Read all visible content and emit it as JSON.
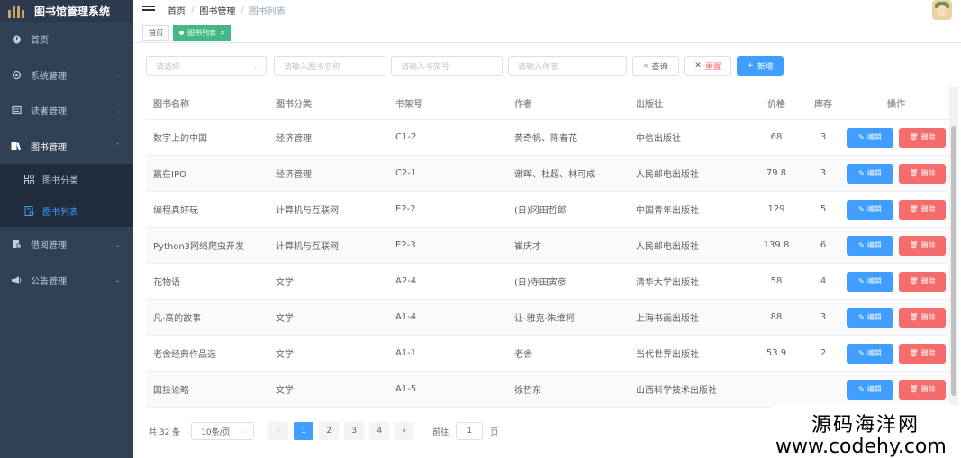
{
  "app": {
    "title": "图书馆管理系统"
  },
  "sidebar": {
    "items": [
      {
        "label": "首页",
        "icon": "dashboard-icon"
      },
      {
        "label": "系统管理",
        "icon": "gear-icon"
      },
      {
        "label": "读者管理",
        "icon": "reader-icon"
      },
      {
        "label": "图书管理",
        "icon": "books-icon"
      },
      {
        "label": "借阅管理",
        "icon": "borrow-icon"
      },
      {
        "label": "公告管理",
        "icon": "megaphone-icon"
      }
    ],
    "submenu": [
      {
        "label": "图书分类",
        "icon": "category-icon"
      },
      {
        "label": "图书列表",
        "icon": "list-icon"
      }
    ]
  },
  "header": {
    "breadcrumb": [
      "首页",
      "图书管理",
      "图书列表"
    ]
  },
  "tags": {
    "home": "首页",
    "active": "图书列表"
  },
  "filters": {
    "category_placeholder": "请选择",
    "name_placeholder": "请输入图书名称",
    "shelf_placeholder": "请输入书架号",
    "author_placeholder": "请输入作者",
    "search_label": "查询",
    "reset_label": "重置",
    "add_label": "新增"
  },
  "table": {
    "headers": [
      "图书名称",
      "图书分类",
      "书架号",
      "作者",
      "出版社",
      "价格",
      "库存",
      "操作"
    ],
    "edit_label": "编辑",
    "delete_label": "删除",
    "rows": [
      {
        "name": "数字上的中国",
        "category": "经济管理",
        "shelf": "C1-2",
        "author": "黄奇帆、陈春花",
        "publisher": "中信出版社",
        "price": "68",
        "stock": "3"
      },
      {
        "name": "赢在IPO",
        "category": "经济管理",
        "shelf": "C2-1",
        "author": "谢晖、杜超、林可成",
        "publisher": "人民邮电出版社",
        "price": "79.8",
        "stock": "3"
      },
      {
        "name": "编程真好玩",
        "category": "计算机与互联网",
        "shelf": "E2-2",
        "author": "(日)冈田哲郎",
        "publisher": "中国青年出版社",
        "price": "129",
        "stock": "5"
      },
      {
        "name": "Python3网络爬虫开发",
        "category": "计算机与互联网",
        "shelf": "E2-3",
        "author": "崔庆才",
        "publisher": "人民邮电出版社",
        "price": "139.8",
        "stock": "6"
      },
      {
        "name": "花物语",
        "category": "文学",
        "shelf": "A2-4",
        "author": "(日)寺田寅彦",
        "publisher": "清华大学出版社",
        "price": "58",
        "stock": "4"
      },
      {
        "name": "凡·高的故事",
        "category": "文学",
        "shelf": "A1-4",
        "author": "让-雅克·朱维柯",
        "publisher": "上海书画出版社",
        "price": "88",
        "stock": "3"
      },
      {
        "name": "老舍经典作品选",
        "category": "文学",
        "shelf": "A1-1",
        "author": "老舍",
        "publisher": "当代世界出版社",
        "price": "53.9",
        "stock": "2"
      },
      {
        "name": "国技论略",
        "category": "文学",
        "shelf": "A1-5",
        "author": "徐哲东",
        "publisher": "山西科学技术出版社",
        "price": "",
        "stock": ""
      }
    ]
  },
  "pagination": {
    "total": "共 32 条",
    "page_size": "10条/页",
    "pages": [
      "1",
      "2",
      "3",
      "4"
    ],
    "goto_label": "前往",
    "goto_value": "1",
    "page_unit": "页"
  },
  "watermark": {
    "line1": "源码海洋网",
    "line2": "www.codehy.com"
  },
  "colors": {
    "primary": "#409eff",
    "danger": "#f56c6c",
    "sidebar": "#304156",
    "tag_active": "#42b983"
  }
}
